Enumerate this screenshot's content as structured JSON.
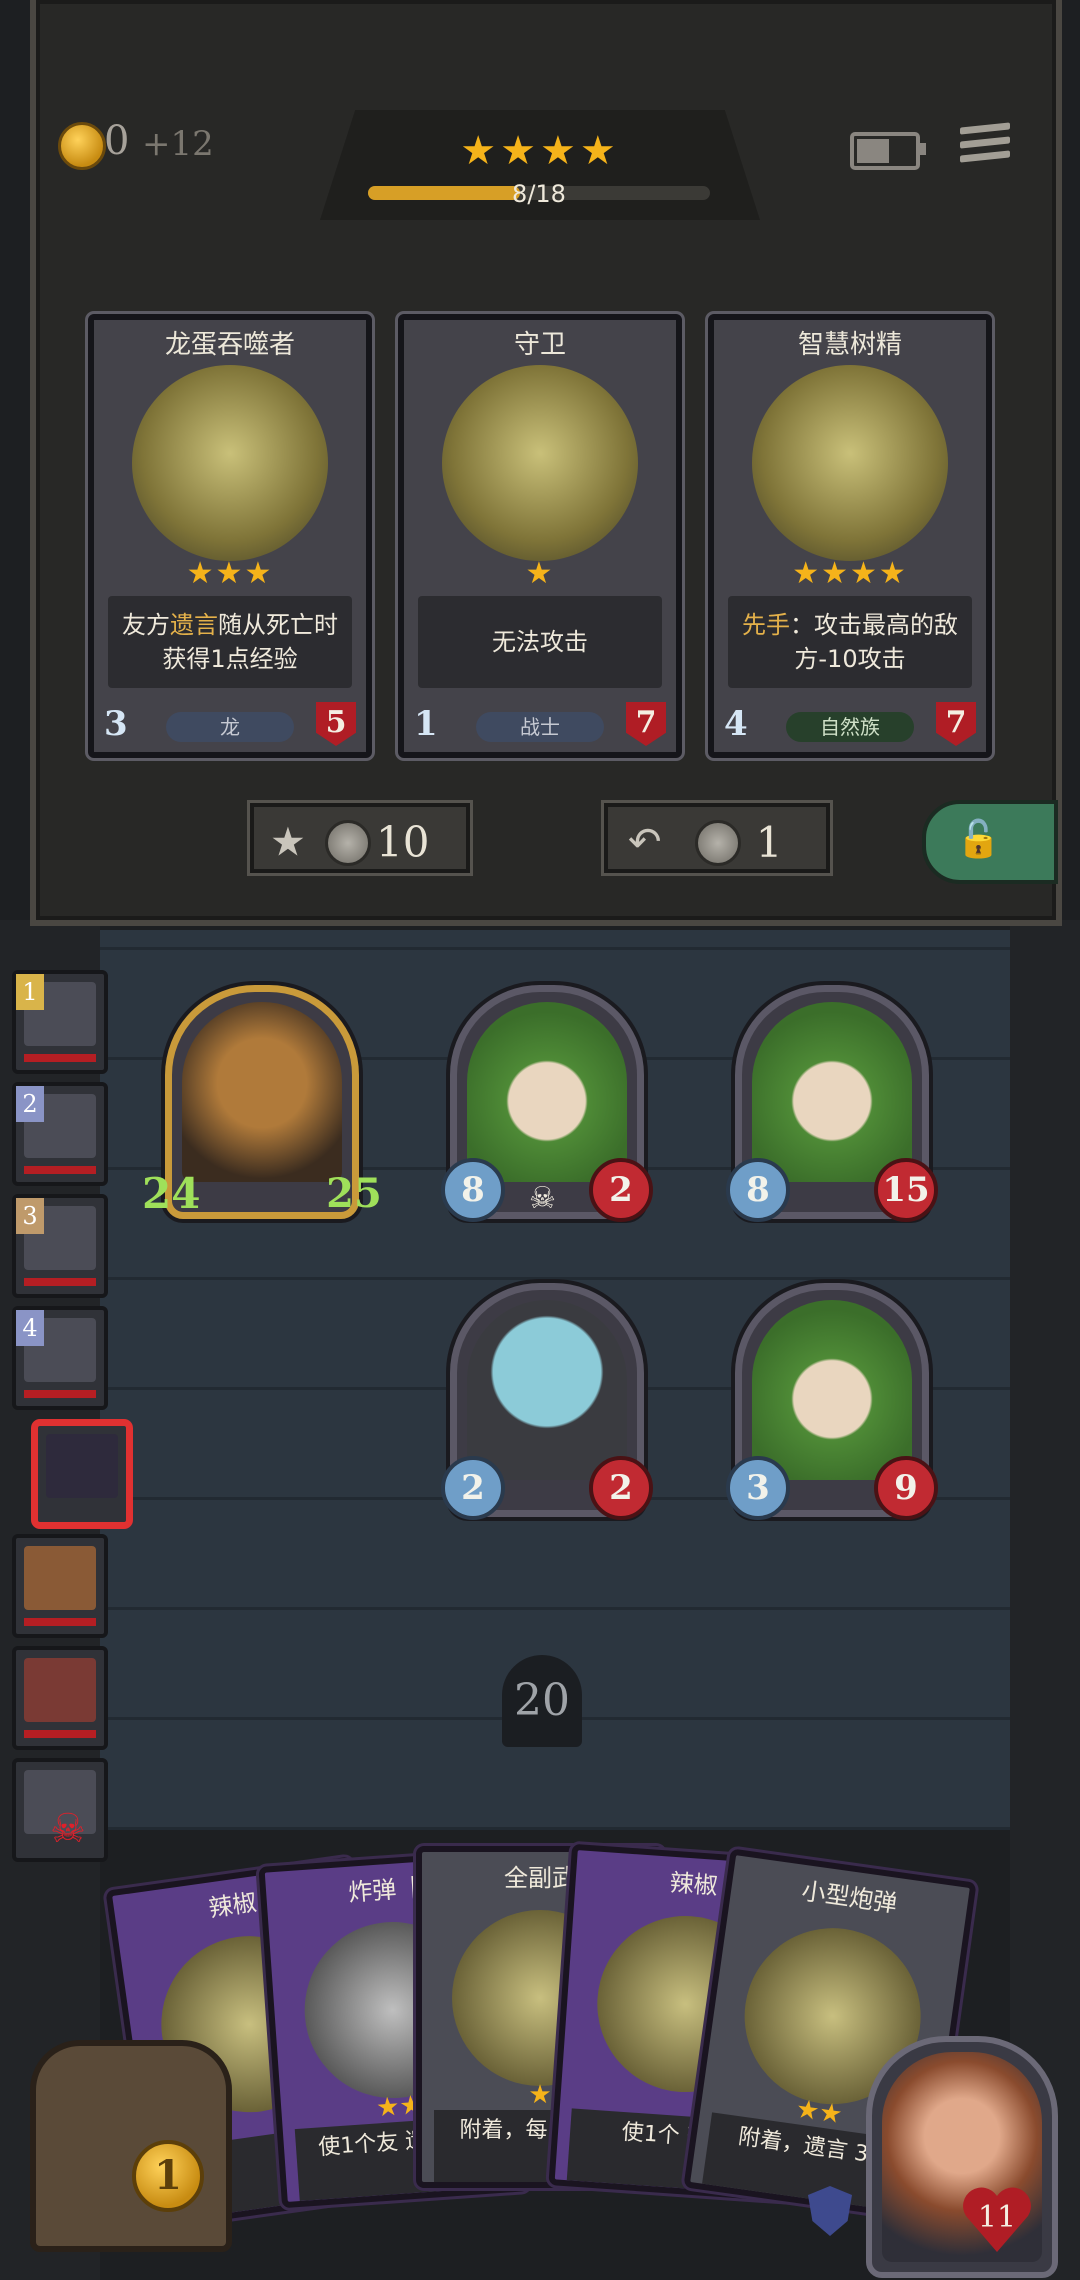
{
  "top_bar": {
    "gold": "0",
    "gold_income": "+12",
    "tier_stars": "★★★★",
    "xp_text": "8/18",
    "xp_progress": 0.444
  },
  "shop_cards": [
    {
      "name": "龙蛋吞噬者",
      "stars": "★★★",
      "desc_a": "友方",
      "desc_hl": "遗言",
      "desc_b": "随从死亡时获得1点经验",
      "attack": "3",
      "health": "5",
      "tribe": "龙"
    },
    {
      "name": "守卫",
      "stars": "★",
      "desc_a": "无法攻击",
      "desc_hl": "",
      "desc_b": "",
      "attack": "1",
      "health": "7",
      "tribe": "战士"
    },
    {
      "name": "智慧树精",
      "stars": "★★★★",
      "desc_a": "",
      "desc_hl": "先手",
      "desc_b": "：攻击最高的敌方-10攻击",
      "attack": "4",
      "health": "7",
      "tribe": "自然族"
    }
  ],
  "shop_buttons": {
    "upgrade_cost": "10",
    "refresh_cost": "1"
  },
  "players": [
    {
      "rank": "1"
    },
    {
      "rank": "2"
    },
    {
      "rank": "3"
    },
    {
      "rank": "4"
    },
    {
      "rank": ""
    },
    {
      "rank": ""
    },
    {
      "rank": ""
    },
    {
      "rank": ""
    }
  ],
  "board_minions": [
    {
      "attack": "24",
      "health": "25"
    },
    {
      "attack": "8",
      "health": "2"
    },
    {
      "attack": "8",
      "health": "15"
    },
    {
      "attack": "2",
      "health": "2"
    },
    {
      "attack": "3",
      "health": "9"
    }
  ],
  "timer": "20",
  "hand_cards": [
    {
      "name": "辣椒",
      "stars": "",
      "desc": ""
    },
    {
      "name": "炸弹【",
      "stars": "★★",
      "desc": "使1个友 遗言: 伤"
    },
    {
      "name": "全副武",
      "stars": "★",
      "desc": "附着，每 备，获"
    },
    {
      "name": "辣椒",
      "stars": "",
      "desc": "使1个 获得"
    },
    {
      "name": "小型炮弹",
      "stars": "★★",
      "desc": "附着，遗言 3点"
    }
  ],
  "chest_coin": "1",
  "hero_health": "11",
  "colors": {
    "gold": "#f5b31a",
    "health_red": "#b01d25",
    "attack_blue": "#6f9ec8",
    "buffed_green": "#9fe05a"
  }
}
